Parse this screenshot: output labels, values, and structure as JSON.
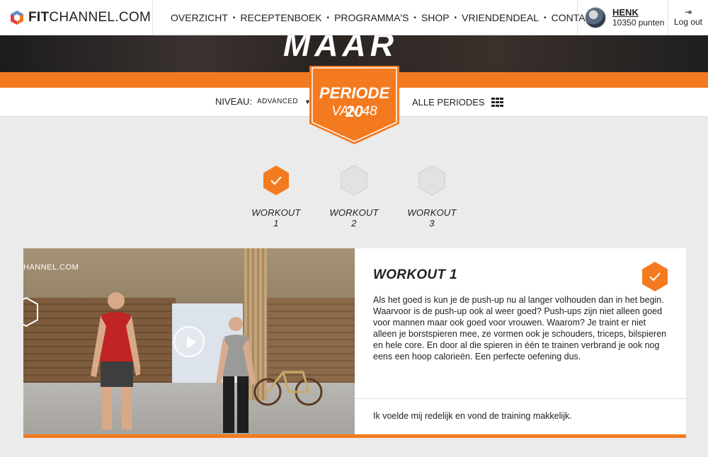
{
  "header": {
    "logo_bold": "FIT",
    "logo_rest": "CHANNEL.COM",
    "nav": [
      "OVERZICHT",
      "RECEPTENBOEK",
      "PROGRAMMA'S",
      "SHOP",
      "VRIENDENDEAL",
      "CONTACT"
    ],
    "nav_separator": "•",
    "user": {
      "name": "HENK",
      "points": "10350 punten"
    },
    "logout_label": "Log out",
    "logout_icon": "logout-icon"
  },
  "hero": {
    "overlay_text": "MAAR"
  },
  "period": {
    "niveau_label": "NIVEAU:",
    "niveau_value": "ADVANCED",
    "badge_line1": "PERIODE 20",
    "badge_line2": "VAN 48",
    "all_periods_label": "ALLE PERIODES"
  },
  "workouts": [
    {
      "label": "WORKOUT 1",
      "completed": true
    },
    {
      "label": "WORKOUT 2",
      "completed": false
    },
    {
      "label": "WORKOUT 3",
      "completed": false
    }
  ],
  "card": {
    "video_logo": "HANNEL.COM",
    "title": "WORKOUT 1",
    "description": "Als het goed is kun je de push-up nu al langer volhouden dan in het begin. Waarvoor is de push-up ook al weer goed?  Push-ups zijn niet alleen goed voor mannen maar ook goed voor vrouwen. Waarom? Je traint er niet alleen je borstspieren mee, ze vormen ook je schouders, triceps, bilspieren en hele core. En door al die spieren in één te trainen verbrand je ook nog eens een hoop calorieën. Een perfecte oefening dus.",
    "feedback": "Ik voelde mij redelijk en vond de training makkelijk."
  },
  "colors": {
    "accent": "#f47a1f",
    "inactive_hex": "#e2e2e2",
    "background": "#ebebeb"
  }
}
